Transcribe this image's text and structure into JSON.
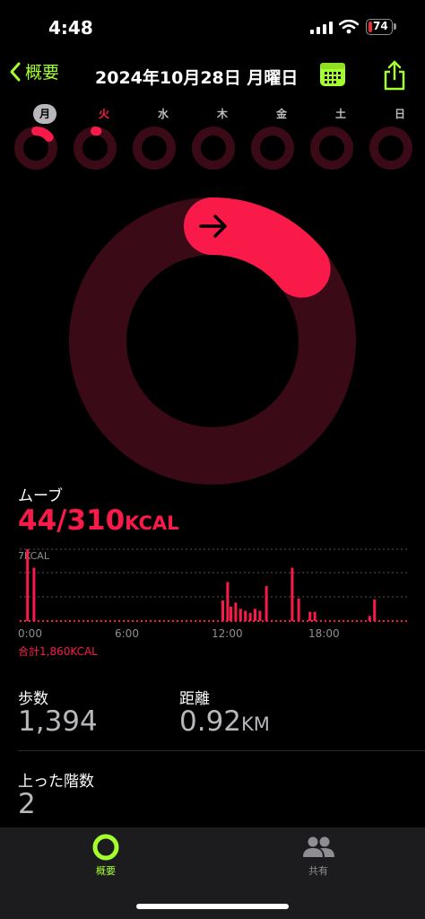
{
  "status": {
    "time": "4:48",
    "battery": "74"
  },
  "nav": {
    "back_label": "概要",
    "title": "2024年10月28日 月曜日",
    "calendar_icon": "calendar-icon",
    "share_icon": "share-icon"
  },
  "week": {
    "days": [
      "月",
      "火",
      "水",
      "木",
      "金",
      "土",
      "日"
    ],
    "selected_index": 0,
    "progress": [
      0.14,
      0.02,
      0,
      0,
      0,
      0,
      0
    ]
  },
  "move": {
    "title": "ムーブ",
    "value": "44/310",
    "unit": "KCAL",
    "progress": 0.142,
    "color": "#fa1a4a"
  },
  "chart": {
    "ymax_label": "7KCAL",
    "x_labels": [
      "0:00",
      "6:00",
      "12:00",
      "18:00"
    ],
    "total": "合計1,860KCAL"
  },
  "chart_data": {
    "type": "bar",
    "x_range": [
      "0:00",
      "24:00"
    ],
    "ylabel": "7KCAL",
    "ylim": [
      0,
      7
    ],
    "bar_color": "#fa1a4a",
    "bars": [
      {
        "t": 0.4,
        "v": 7.0
      },
      {
        "t": 0.8,
        "v": 5.2
      },
      {
        "t": 12.5,
        "v": 2.0
      },
      {
        "t": 12.8,
        "v": 3.8
      },
      {
        "t": 13.0,
        "v": 1.4
      },
      {
        "t": 13.3,
        "v": 1.8
      },
      {
        "t": 13.6,
        "v": 1.2
      },
      {
        "t": 13.9,
        "v": 1.0
      },
      {
        "t": 14.2,
        "v": 0.8
      },
      {
        "t": 14.5,
        "v": 1.2
      },
      {
        "t": 14.8,
        "v": 1.0
      },
      {
        "t": 15.2,
        "v": 3.4
      },
      {
        "t": 16.8,
        "v": 5.2
      },
      {
        "t": 17.2,
        "v": 2.2
      },
      {
        "t": 17.9,
        "v": 0.9
      },
      {
        "t": 18.2,
        "v": 0.9
      },
      {
        "t": 21.6,
        "v": 0.5
      },
      {
        "t": 21.9,
        "v": 2.1
      }
    ]
  },
  "stats": {
    "steps": {
      "label": "歩数",
      "value": "1,394"
    },
    "distance": {
      "label": "距離",
      "value": "0.92",
      "unit": "KM"
    },
    "floors": {
      "label": "上った階数",
      "value": "2"
    }
  },
  "tabs": [
    {
      "label": "概要",
      "icon": "activity-rings-icon",
      "active": true,
      "color": "#a5ff2e"
    },
    {
      "label": "共有",
      "icon": "people-icon",
      "active": false,
      "color": "#8e8e93"
    }
  ]
}
